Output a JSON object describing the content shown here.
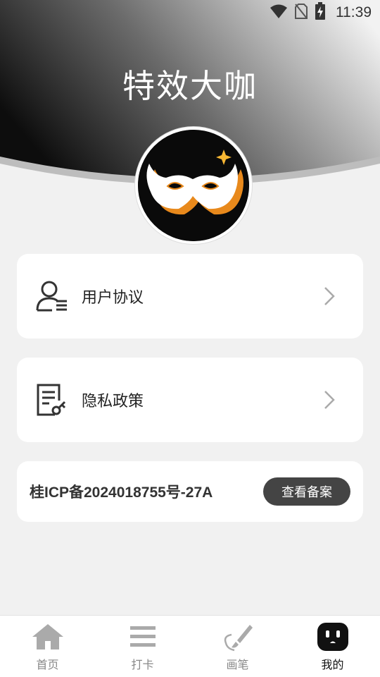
{
  "status_bar": {
    "time": "11:39",
    "icons": [
      "wifi-icon",
      "no-sim-icon",
      "battery-charging-icon"
    ]
  },
  "header": {
    "title": "特效大咖"
  },
  "avatar": {
    "icon": "mask-logo-icon"
  },
  "menu": [
    {
      "label": "用户协议",
      "icon": "user-agreement-icon"
    },
    {
      "label": "隐私政策",
      "icon": "privacy-policy-icon"
    }
  ],
  "icp": {
    "text": "桂ICP备2024018755号-27A",
    "button_label": "查看备案"
  },
  "bottom_nav": {
    "items": [
      {
        "label": "首页",
        "icon": "home-icon",
        "active": false
      },
      {
        "label": "打卡",
        "icon": "menu-lines-icon",
        "active": false
      },
      {
        "label": "画笔",
        "icon": "brush-icon",
        "active": false
      },
      {
        "label": "我的",
        "icon": "profile-face-icon",
        "active": true
      }
    ]
  },
  "colors": {
    "page_bg": "#f1f1f1",
    "card_bg": "#ffffff",
    "button_bg": "#444444",
    "active_nav": "#111111",
    "inactive_nav": "#888888"
  }
}
